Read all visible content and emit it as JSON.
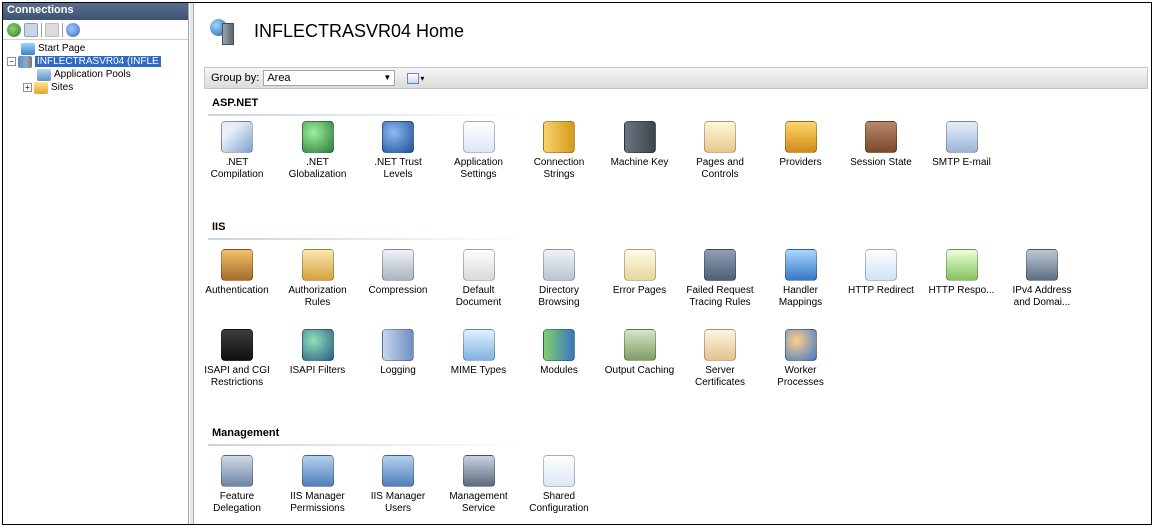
{
  "connections": {
    "header": "Connections",
    "tree": [
      {
        "label": "Start Page",
        "level": 1
      },
      {
        "label": "INFLECTRASVR04 (INFLE",
        "level": 1,
        "selected": true
      },
      {
        "label": "Application Pools",
        "level": 2
      },
      {
        "label": "Sites",
        "level": 2
      }
    ]
  },
  "home": {
    "title": "INFLECTRASVR04 Home"
  },
  "groupbar": {
    "label": "Group by:",
    "value": "Area"
  },
  "sections": {
    "aspnet": {
      "title": "ASP.NET",
      "items": [
        {
          "label": ".NET Compilation",
          "icon": "compilation-icon"
        },
        {
          "label": ".NET Globalization",
          "icon": "globe-icon"
        },
        {
          "label": ".NET Trust Levels",
          "icon": "trust-icon"
        },
        {
          "label": "Application Settings",
          "icon": "settings-list-icon"
        },
        {
          "label": "Connection Strings",
          "icon": "database-icon"
        },
        {
          "label": "Machine Key",
          "icon": "key-icon"
        },
        {
          "label": "Pages and Controls",
          "icon": "pages-icon"
        },
        {
          "label": "Providers",
          "icon": "providers-icon"
        },
        {
          "label": "Session State",
          "icon": "session-icon"
        },
        {
          "label": "SMTP E-mail",
          "icon": "email-icon"
        }
      ]
    },
    "iis": {
      "title": "IIS",
      "items": [
        {
          "label": "Authentication",
          "icon": "auth-icon"
        },
        {
          "label": "Authorization Rules",
          "icon": "lock-icon"
        },
        {
          "label": "Compression",
          "icon": "compression-icon"
        },
        {
          "label": "Default Document",
          "icon": "document-icon"
        },
        {
          "label": "Directory Browsing",
          "icon": "directory-icon"
        },
        {
          "label": "Error Pages",
          "icon": "error-page-icon"
        },
        {
          "label": "Failed Request Tracing Rules",
          "icon": "failed-request-icon"
        },
        {
          "label": "Handler Mappings",
          "icon": "handler-icon"
        },
        {
          "label": "HTTP Redirect",
          "icon": "redirect-icon"
        },
        {
          "label": "HTTP Respo...",
          "icon": "http-response-icon"
        },
        {
          "label": "IPv4 Address and Domai...",
          "icon": "ipv4-icon"
        },
        {
          "label": "ISAPI and CGI Restrictions",
          "icon": "cgi-icon"
        },
        {
          "label": "ISAPI Filters",
          "icon": "filter-icon"
        },
        {
          "label": "Logging",
          "icon": "logging-icon"
        },
        {
          "label": "MIME Types",
          "icon": "mime-icon"
        },
        {
          "label": "Modules",
          "icon": "modules-icon"
        },
        {
          "label": "Output Caching",
          "icon": "caching-icon"
        },
        {
          "label": "Server Certificates",
          "icon": "certificate-icon"
        },
        {
          "label": "Worker Processes",
          "icon": "worker-icon"
        }
      ]
    },
    "management": {
      "title": "Management",
      "items": [
        {
          "label": "Feature Delegation",
          "icon": "delegation-icon"
        },
        {
          "label": "IIS Manager Permissions",
          "icon": "permissions-icon"
        },
        {
          "label": "IIS Manager Users",
          "icon": "users-icon"
        },
        {
          "label": "Management Service",
          "icon": "mgmt-service-icon"
        },
        {
          "label": "Shared Configuration",
          "icon": "shared-config-icon"
        }
      ]
    }
  }
}
